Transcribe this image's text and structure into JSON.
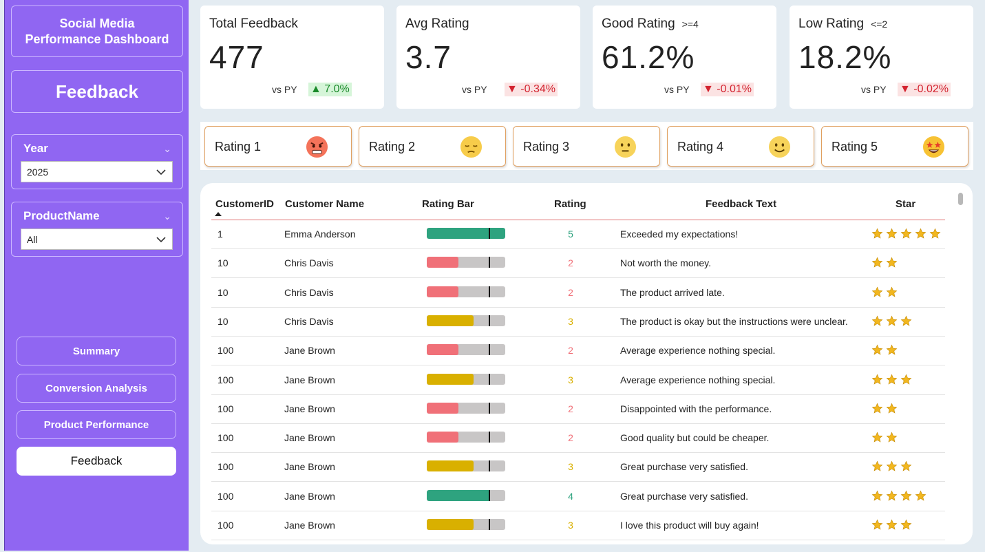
{
  "sidebar": {
    "title_line1": "Social Media",
    "title_line2": "Performance Dashboard",
    "page_label": "Feedback",
    "year_slicer": {
      "label": "Year",
      "value": "2025"
    },
    "product_slicer": {
      "label": "ProductName",
      "value": "All"
    },
    "nav": [
      {
        "label": "Summary",
        "active": false
      },
      {
        "label": "Conversion Analysis",
        "active": false
      },
      {
        "label": "Product Performance",
        "active": false
      },
      {
        "label": "Feedback",
        "active": true
      }
    ]
  },
  "kpis": [
    {
      "title": "Total Feedback",
      "sub": "",
      "value": "477",
      "vs": "vs PY",
      "delta": "7.0%",
      "direction": "up"
    },
    {
      "title": "Avg Rating",
      "sub": "",
      "value": "3.7",
      "vs": "vs PY",
      "delta": "-0.34%",
      "direction": "down"
    },
    {
      "title": "Good Rating",
      "sub": ">=4",
      "value": "61.2%",
      "vs": "vs PY",
      "delta": "-0.01%",
      "direction": "down"
    },
    {
      "title": "Low Rating",
      "sub": "<=2",
      "value": "18.2%",
      "vs": "vs PY",
      "delta": "-0.02%",
      "direction": "down"
    }
  ],
  "ratings": [
    {
      "label": "Rating 1",
      "icon": "angry-face-icon"
    },
    {
      "label": "Rating 2",
      "icon": "pensive-face-icon"
    },
    {
      "label": "Rating 3",
      "icon": "neutral-face-icon"
    },
    {
      "label": "Rating 4",
      "icon": "smiling-face-icon"
    },
    {
      "label": "Rating 5",
      "icon": "star-struck-face-icon"
    }
  ],
  "table": {
    "headers": {
      "customer_id": "CustomerID",
      "customer_name": "Customer Name",
      "rating_bar": "Rating Bar",
      "rating": "Rating",
      "feedback_text": "Feedback Text",
      "star": "Star"
    },
    "rows": [
      {
        "id": "1",
        "name": "Emma Anderson",
        "rating": "5",
        "feedback": "Exceeded my expectations!"
      },
      {
        "id": "10",
        "name": "Chris Davis",
        "rating": "2",
        "feedback": "Not worth the money."
      },
      {
        "id": "10",
        "name": "Chris Davis",
        "rating": "2",
        "feedback": "The product arrived late."
      },
      {
        "id": "10",
        "name": "Chris Davis",
        "rating": "3",
        "feedback": "The product is okay but the instructions were unclear."
      },
      {
        "id": "100",
        "name": "Jane Brown",
        "rating": "2",
        "feedback": "Average experience nothing special."
      },
      {
        "id": "100",
        "name": "Jane Brown",
        "rating": "3",
        "feedback": "Average experience nothing special."
      },
      {
        "id": "100",
        "name": "Jane Brown",
        "rating": "2",
        "feedback": "Disappointed with the performance."
      },
      {
        "id": "100",
        "name": "Jane Brown",
        "rating": "2",
        "feedback": "Good quality but could be cheaper."
      },
      {
        "id": "100",
        "name": "Jane Brown",
        "rating": "3",
        "feedback": "Great purchase very satisfied."
      },
      {
        "id": "100",
        "name": "Jane Brown",
        "rating": "4",
        "feedback": "Great purchase very satisfied."
      },
      {
        "id": "100",
        "name": "Jane Brown",
        "rating": "3",
        "feedback": "I love this product will buy again!"
      }
    ]
  },
  "colors": {
    "sidebar": "#9066f2",
    "rating_high": "#2ea37f",
    "rating_mid": "#d9b000",
    "rating_low": "#f07078",
    "bar_track": "#c8c6c6",
    "star": "#f2b71f",
    "delta_up": "#1a8a2a",
    "delta_down": "#d3232f"
  }
}
